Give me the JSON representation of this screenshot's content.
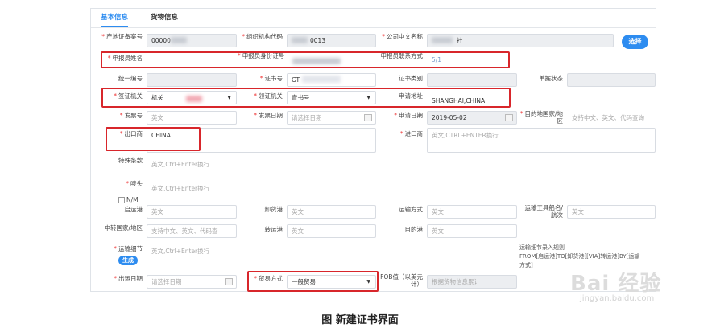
{
  "tabs": [
    {
      "label": "基本信息",
      "active": true
    },
    {
      "label": "货物信息",
      "active": false
    }
  ],
  "labels": {
    "origin_cert_no": "产地证备案号",
    "org_code": "组织机构代码",
    "company_cn": "公司中文名称",
    "applicant_name": "申报员姓名",
    "applicant_id": "申报员身份证号",
    "applicant_contact": "申报员联系方式",
    "unified_no": "统一编号",
    "cert_no": "证书号",
    "cert_type": "证书类别",
    "doc_status": "单据状态",
    "issuing_authority": "签证机关",
    "receiving_authority": "领证机关",
    "apply_address": "申请地址",
    "invoice_no": "发票号",
    "invoice_date": "发票日期",
    "apply_date": "申请日期",
    "destination": "目的地国家/地区",
    "exporter": "出口商",
    "importer": "进口商",
    "special_terms": "特殊条款",
    "marks": "唛头",
    "nm": "N/M",
    "port_loading": "启运港",
    "port_unloading": "卸货港",
    "transport_mode": "运输方式",
    "vessel": "运输工具船名/航次",
    "transit_country": "中转国家/地区",
    "transit_port": "转运港",
    "dest_port": "目的港",
    "transport_detail": "运输细节",
    "export_date": "出运日期",
    "trade_mode": "贸易方式",
    "fob_value": "FOB值（以美元计）"
  },
  "values": {
    "origin_cert_no": "00000",
    "org_code": "0013",
    "company_cn": "社",
    "applicant_contact": "5/1",
    "cert_no": "GT",
    "issuing_authority": "机关",
    "receiving_authority": "青书号",
    "apply_address": "SHANGHAI,CHINA",
    "apply_date": "2019-05-02",
    "exporter": "CHINA",
    "trade_mode": "一般贸易"
  },
  "placeholders": {
    "invoice_no": "英文",
    "invoice_date": "请选择日期",
    "destination": "支持中文、英文、代码查询",
    "importer": "英文,CTRL+ENTER换行",
    "special_terms": "英文,Ctrl+Enter换行",
    "marks": "英文,Ctrl+Enter换行",
    "port_loading": "英文",
    "port_unloading": "英文",
    "transport_mode": "英文",
    "vessel": "英文",
    "transit_country": "支持中文、英文、代码查",
    "transit_port": "英文",
    "dest_port": "英文",
    "transport_detail": "英文,Ctrl+Enter换行",
    "export_date": "请选择日期",
    "fob_value": "根据货物信息累计"
  },
  "buttons": {
    "select": "选择",
    "generate": "生成"
  },
  "transport_hint": [
    "运输细节录入规则",
    "FROM[启运港]TO[卸货港][VIA]转运港]BY[运输",
    "方式]"
  ],
  "caption": "图  新建证书界面",
  "watermark": {
    "line1": "Bai 经验",
    "line2": "jingyan.baidu.com"
  },
  "colors": {
    "accent": "#2d8cf0",
    "highlight": "#d8262b",
    "required": "#e33"
  }
}
